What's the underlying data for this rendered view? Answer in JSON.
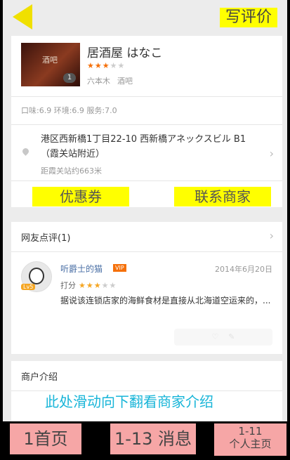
{
  "header": {
    "write_review": "写评价"
  },
  "shop": {
    "thumb_sign": "酒吧",
    "thumb_count": "1",
    "name": "居酒屋 はなこ",
    "stars_on": "★★★",
    "stars_off": "★★",
    "area": "六本木",
    "category": "酒吧",
    "scores": "口味:6.9 环境:6.9 服务:7.0",
    "address": "港区西新橋1丁目22-10 西新橋アネックスビル B1（霞关站附近）",
    "distance": "距霞关站约663米",
    "coupon": "优惠券",
    "contact": "联系商家"
  },
  "reviews": {
    "title": "网友点评(1)",
    "user": "听爵士的猫",
    "vip": "VIP",
    "level": "Lv5",
    "date": "2014年6月20日",
    "rate_label": "打分",
    "rate_on": "★★★",
    "rate_off": "★★",
    "text": "据说该连锁店家的海鲜食材是直接从北海道空运来的，..."
  },
  "merchant": {
    "title": "商户介绍"
  },
  "hint": "此处滑动向下翻看商家介绍",
  "tabs": {
    "home": "1首页",
    "messages": "1-13 消息",
    "profile_num": "1-11",
    "profile": "个人主页"
  }
}
